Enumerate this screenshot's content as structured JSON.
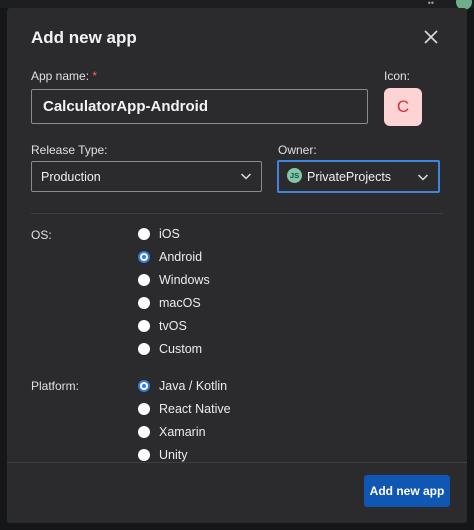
{
  "dialog": {
    "title": "Add new app",
    "close_icon": "close-icon",
    "submit_label": "Add new app"
  },
  "app_name": {
    "label": "App name:",
    "required_mark": "*",
    "value": "CalculatorApp-Android"
  },
  "icon": {
    "label": "Icon:",
    "letter": "C",
    "bg_color": "#fdd3d3",
    "text_color": "#d13434"
  },
  "release_type": {
    "label": "Release Type:",
    "selected": "Production"
  },
  "owner": {
    "label": "Owner:",
    "selected": "PrivateProjects",
    "avatar_initials": "JS"
  },
  "os": {
    "label": "OS:",
    "options": [
      "iOS",
      "Android",
      "Windows",
      "macOS",
      "tvOS",
      "Custom"
    ],
    "selected": "Android"
  },
  "platform": {
    "label": "Platform:",
    "options": [
      "Java / Kotlin",
      "React Native",
      "Xamarin",
      "Unity"
    ],
    "selected": "Java / Kotlin"
  },
  "colors": {
    "accent": "#2f7de1",
    "primary_button": "#0f57b2",
    "dialog_bg": "#2b2b2e"
  }
}
